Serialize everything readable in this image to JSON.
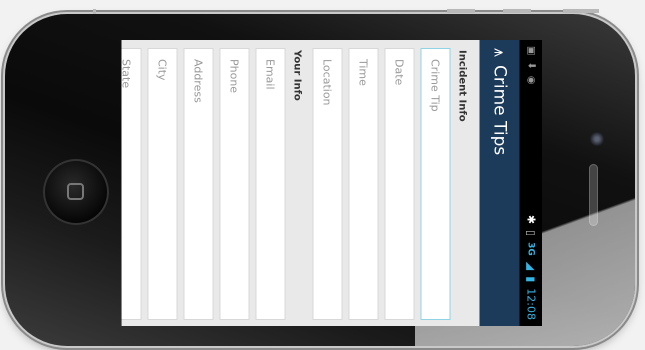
{
  "status_bar": {
    "notification_icons": [
      "image-icon",
      "download-icon",
      "app-icon"
    ],
    "signal_label": "3G",
    "time": "12:08"
  },
  "action_bar": {
    "title": "Crime Tips",
    "app_icon": "tower-icon"
  },
  "form": {
    "incident_header": "Incident Info",
    "crime_tip_placeholder": "Crime Tip",
    "date_placeholder": "Date",
    "time_placeholder": "Time",
    "location_placeholder": "Location",
    "your_info_header": "Your Info",
    "email_placeholder": "Email",
    "phone_placeholder": "Phone",
    "address_placeholder": "Address",
    "city_placeholder": "City",
    "state_placeholder": "State"
  },
  "colors": {
    "action_bar": "#1c3a5a",
    "status_accent": "#33b5e5",
    "focus_border": "#8fd3e5"
  }
}
